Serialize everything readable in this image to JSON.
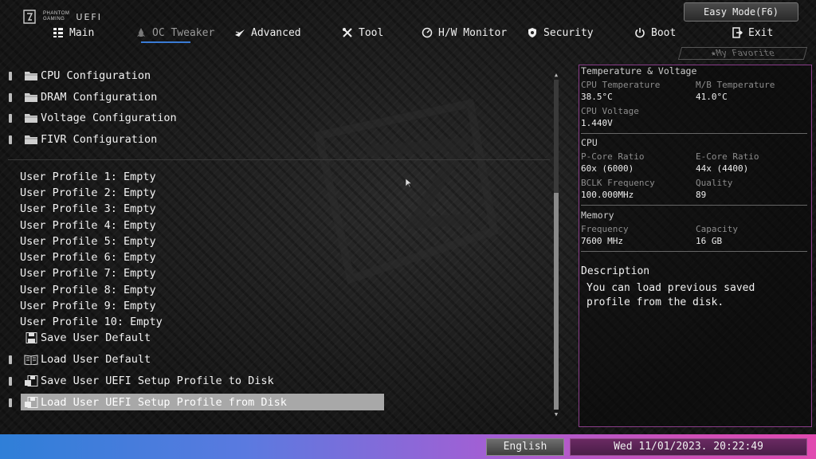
{
  "header": {
    "brand_line1": "PHANTOM",
    "brand_line2": "GAMING",
    "uefi_label": "UEFI",
    "easy_mode_label": "Easy Mode(F6)",
    "favorite_label": "My Favorite"
  },
  "nav": {
    "items": [
      {
        "label": "Main",
        "icon": "menu-list-icon"
      },
      {
        "label": "OC Tweaker",
        "icon": "rocket-icon",
        "active": true
      },
      {
        "label": "Advanced",
        "icon": "star-jet-icon"
      },
      {
        "label": "Tool",
        "icon": "tools-icon"
      },
      {
        "label": "H/W Monitor",
        "icon": "monitor-dial-icon"
      },
      {
        "label": "Security",
        "icon": "shield-icon"
      },
      {
        "label": "Boot",
        "icon": "power-icon"
      },
      {
        "label": "Exit",
        "icon": "exit-icon"
      }
    ]
  },
  "list": {
    "folders": [
      {
        "label": "CPU Configuration"
      },
      {
        "label": "DRAM Configuration"
      },
      {
        "label": "Voltage Configuration"
      },
      {
        "label": "FIVR Configuration"
      }
    ],
    "profiles": [
      {
        "label": "User Profile 1: Empty"
      },
      {
        "label": "User Profile 2: Empty"
      },
      {
        "label": "User Profile 3: Empty"
      },
      {
        "label": "User Profile 4: Empty"
      },
      {
        "label": "User Profile 5: Empty"
      },
      {
        "label": "User Profile 6: Empty"
      },
      {
        "label": "User Profile 7: Empty"
      },
      {
        "label": "User Profile 8: Empty"
      },
      {
        "label": "User Profile 9: Empty"
      },
      {
        "label": "User Profile 10: Empty"
      }
    ],
    "actions": [
      {
        "label": "Save User Default",
        "icon": "floppy-disk-icon"
      },
      {
        "label": "Load User Default",
        "icon": "load-book-icon"
      },
      {
        "label": "Save User UEFI Setup Profile to Disk",
        "icon": "save-to-disk-icon"
      },
      {
        "label": "Load User UEFI Setup Profile from Disk",
        "icon": "load-from-disk-icon",
        "selected": true
      }
    ]
  },
  "panel": {
    "tv_title": "Temperature & Voltage",
    "cpu_temp_label": "CPU Temperature",
    "cpu_temp_value": "38.5°C",
    "mb_temp_label": "M/B Temperature",
    "mb_temp_value": "41.0°C",
    "cpu_volt_label": "CPU Voltage",
    "cpu_volt_value": "1.440V",
    "cpu_title": "CPU",
    "pcore_label": "P-Core Ratio",
    "pcore_value": "60x (6000)",
    "ecore_label": "E-Core Ratio",
    "ecore_value": "44x (4400)",
    "bclk_label": "BCLK Frequency",
    "bclk_value": "100.000MHz",
    "quality_label": "Quality",
    "quality_value": "89",
    "mem_title": "Memory",
    "freq_label": "Frequency",
    "freq_value": "7600 MHz",
    "cap_label": "Capacity",
    "cap_value": "16 GB",
    "desc_title": "Description",
    "desc_text": "You can load previous saved profile from the disk."
  },
  "footer": {
    "language": "English",
    "datetime": "Wed 11/01/2023. 20:22:49"
  },
  "colors": {
    "nav_underline": "#3a7bd5",
    "panel_border": "#8a3d8a",
    "selected_row": "#a8a8a8"
  }
}
